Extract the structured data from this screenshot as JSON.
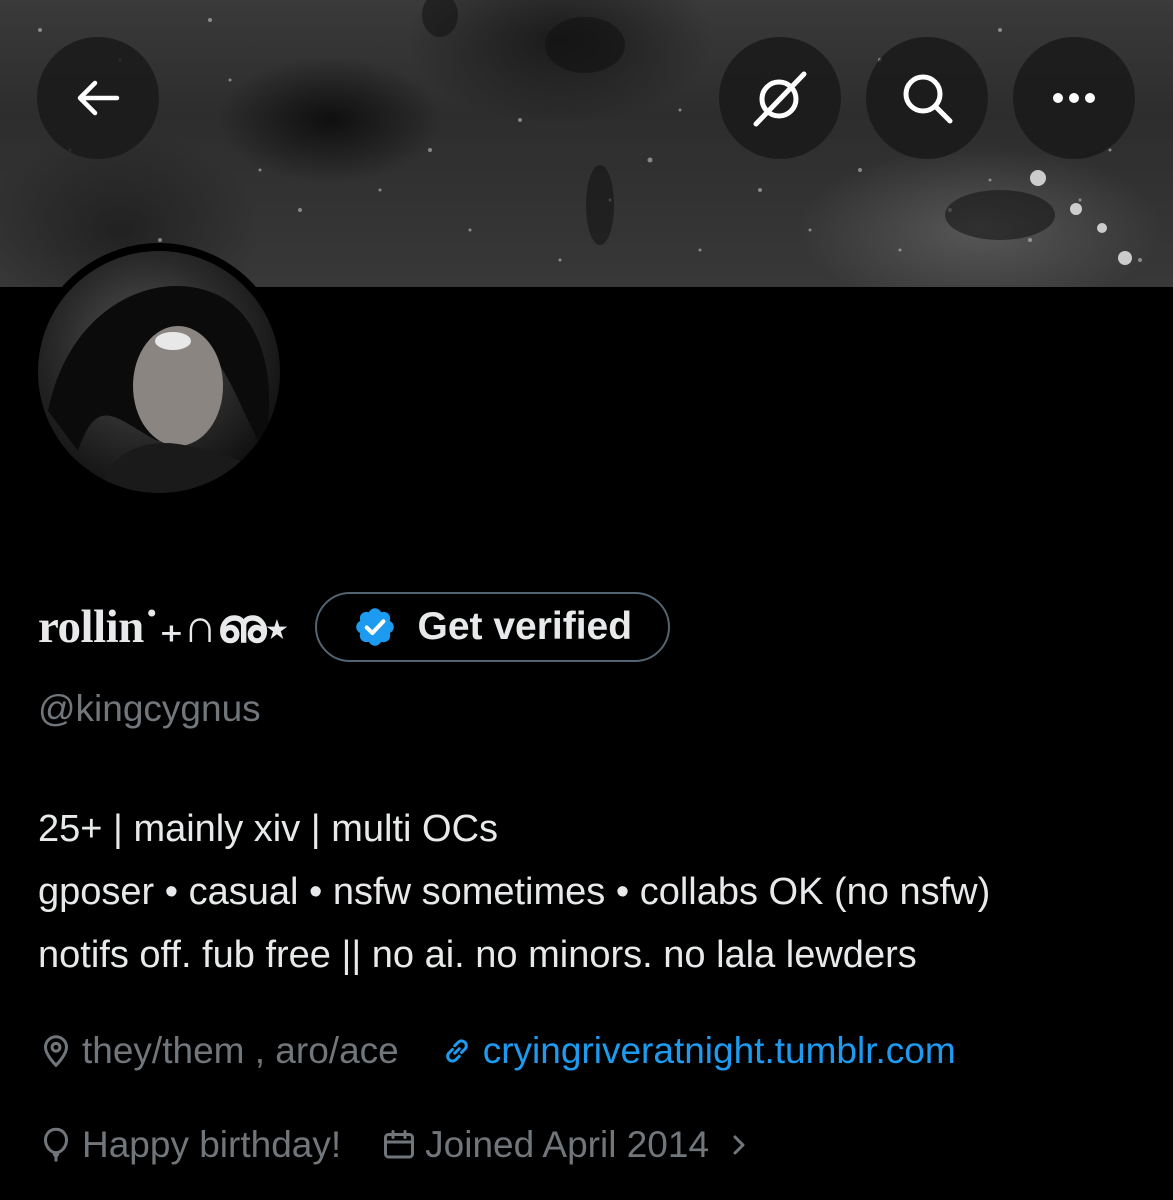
{
  "header": {
    "back_icon": "arrow-left-icon",
    "grok_icon": "grok-icon",
    "search_icon": "search-icon",
    "more_icon": "more-horizontal-icon"
  },
  "profile": {
    "display_name": "rollin˙₊∩ഌ⋆",
    "get_verified_label": "Get verified",
    "handle": "@kingcygnus",
    "bio_lines": [
      "25+ | mainly xiv | multi OCs",
      "gposer • casual • nsfw sometimes • collabs OK (no nsfw)",
      "notifs off. fub free || no ai. no minors. no lala lewders"
    ],
    "location": "they/them , aro/ace",
    "website": "cryingriveratnight.tumblr.com",
    "birthday": "Happy birthday!",
    "joined": "Joined April 2014"
  },
  "colors": {
    "background": "#000000",
    "text_primary": "#e7e9ea",
    "text_secondary": "#71767b",
    "link": "#1d9bf0",
    "verified_badge": "#1d9bf0"
  }
}
